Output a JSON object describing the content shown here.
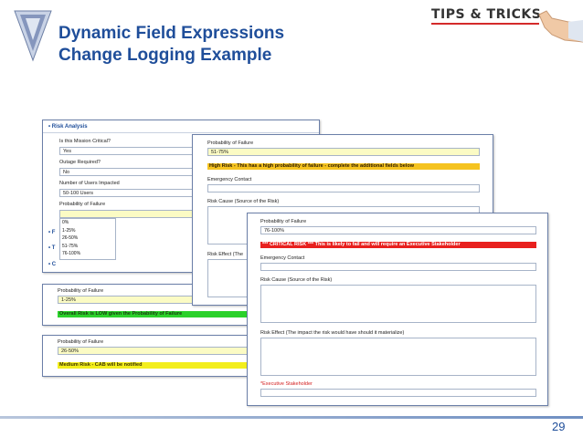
{
  "slide": {
    "title_line1": "Dynamic Field Expressions",
    "title_line2": "Change Logging Example",
    "tips_label": "TIPS & TRICKS",
    "page_number": "29"
  },
  "panel1": {
    "section": "• Risk Analysis",
    "q1_label": "Is this Mission Critical?",
    "q1_value": "Yes",
    "q2_label": "Outage Required?",
    "q2_value": "No",
    "q3_label": "Number of Users Impacted",
    "q3_value": "50-100 Users",
    "q4_label": "Probability of Failure",
    "options": [
      "0%",
      "1-25%",
      "26-50%",
      "51-75%",
      "76-100%"
    ],
    "side1": "• F",
    "side2": "• T",
    "side3": "• C"
  },
  "panel_low": {
    "label": "Probability of Failure",
    "value": "1-25%",
    "banner": "Overall Risk is LOW given the Probability of Failure"
  },
  "panel_med": {
    "label": "Probability of Failure",
    "value": "26-50%",
    "banner": "Medium Risk - CAB will be notified"
  },
  "panel_high": {
    "label": "Probability of Failure",
    "value": "51-75%",
    "banner": "High Risk - This has a high probability of failure - complete the additional fields below",
    "contact_label": "Emergency Contact",
    "cause_label": "Risk Cause (Source of the Risk)",
    "effect_label": "Risk Effect (The"
  },
  "panel_critical": {
    "label": "Probability of Failure",
    "value": "76-100%",
    "banner": "*** CRITICAL RISK *** This is likely to fail and will require an Executive Stakeholder",
    "contact_label": "Emergency Contact",
    "cause_label": "Risk Cause (Source of the Risk)",
    "effect_label": "Risk Effect (The impact the risk would have should it materialize)",
    "stakeholder_label": "*Executive Stakeholder"
  },
  "colors": {
    "title": "#1f4e9a",
    "green": "#2ad12a",
    "yellow": "#f3ee1c",
    "orange": "#f5c320",
    "red": "#e8201e"
  }
}
